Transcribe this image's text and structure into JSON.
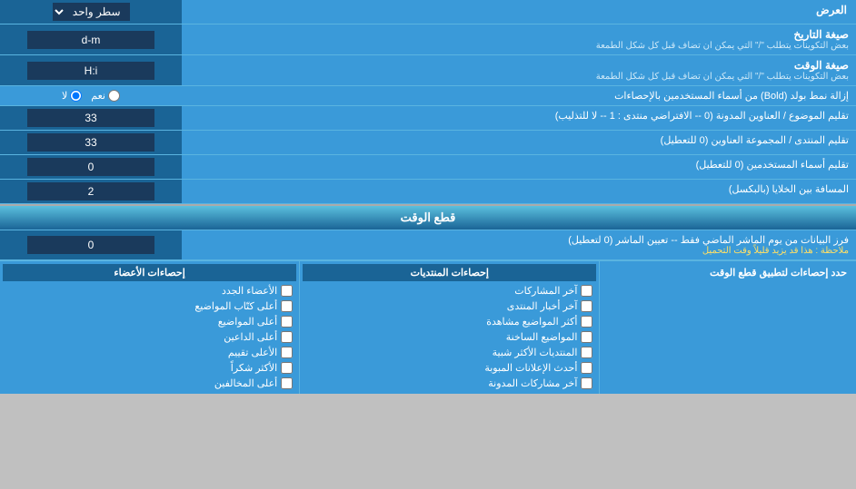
{
  "header": {
    "label": "العرض",
    "select_default": "سطر واحد"
  },
  "rows": [
    {
      "id": "date_format",
      "label": "صيغة التاريخ",
      "sublabel": "بعض التكوينات يتطلب \"/\" التي يمكن ان تضاف قبل كل شكل الطمعة",
      "value": "d-m"
    },
    {
      "id": "time_format",
      "label": "صيغة الوقت",
      "sublabel": "بعض التكوينات يتطلب \"/\" التي يمكن ان تضاف قبل كل شكل الطمعة",
      "value": "H:i"
    },
    {
      "id": "bold_remove",
      "label": "إزالة نمط بولد (Bold) من أسماء المستخدمين بالإحصاءات",
      "radio_yes": "نعم",
      "radio_no": "لا",
      "radio_selected": "no"
    },
    {
      "id": "topic_headers",
      "label": "تقليم الموضوع / العناوين المدونة (0 -- الافتراضي منتدى : 1 -- لا للتذليب)",
      "value": "33"
    },
    {
      "id": "forum_headers",
      "label": "تقليم المنتدى / المجموعة العناوين (0 للتعطيل)",
      "value": "33"
    },
    {
      "id": "usernames",
      "label": "تقليم أسماء المستخدمين (0 للتعطيل)",
      "value": "0"
    },
    {
      "id": "cell_spacing",
      "label": "المسافة بين الخلايا (بالبكسل)",
      "value": "2"
    }
  ],
  "snapshot_section": {
    "title": "قطع الوقت",
    "row": {
      "label": "فرز البيانات من يوم الماشر الماضي فقط -- تعيين الماشر (0 لتعطيل)",
      "note": "ملاحظة : هذا قد يزيد قليلاً وقت التحميل",
      "value": "0"
    },
    "limit_label": "حدد إحصاءات لتطبيق قطع الوقت"
  },
  "columns": {
    "right": {
      "header": "إحصاءات الأعضاء",
      "items": [
        "الأعضاء الجدد",
        "أعلى كتّاب المواضيع",
        "أعلى الداعين",
        "الأعلى تقييم",
        "الأكثر شكراً",
        "أعلى المخالفين"
      ]
    },
    "middle": {
      "header": "إحصاءات المنتديات",
      "items": [
        "آخر المشاركات",
        "آخر أخبار المنتدى",
        "أكثر المواضيع مشاهدة",
        "المواضيع الساخنة",
        "المنتديات الأكثر شبية",
        "أحدث الإعلانات المبوبة",
        "آخر مشاركات المدونة"
      ]
    },
    "left": {
      "header": "",
      "items": []
    }
  }
}
